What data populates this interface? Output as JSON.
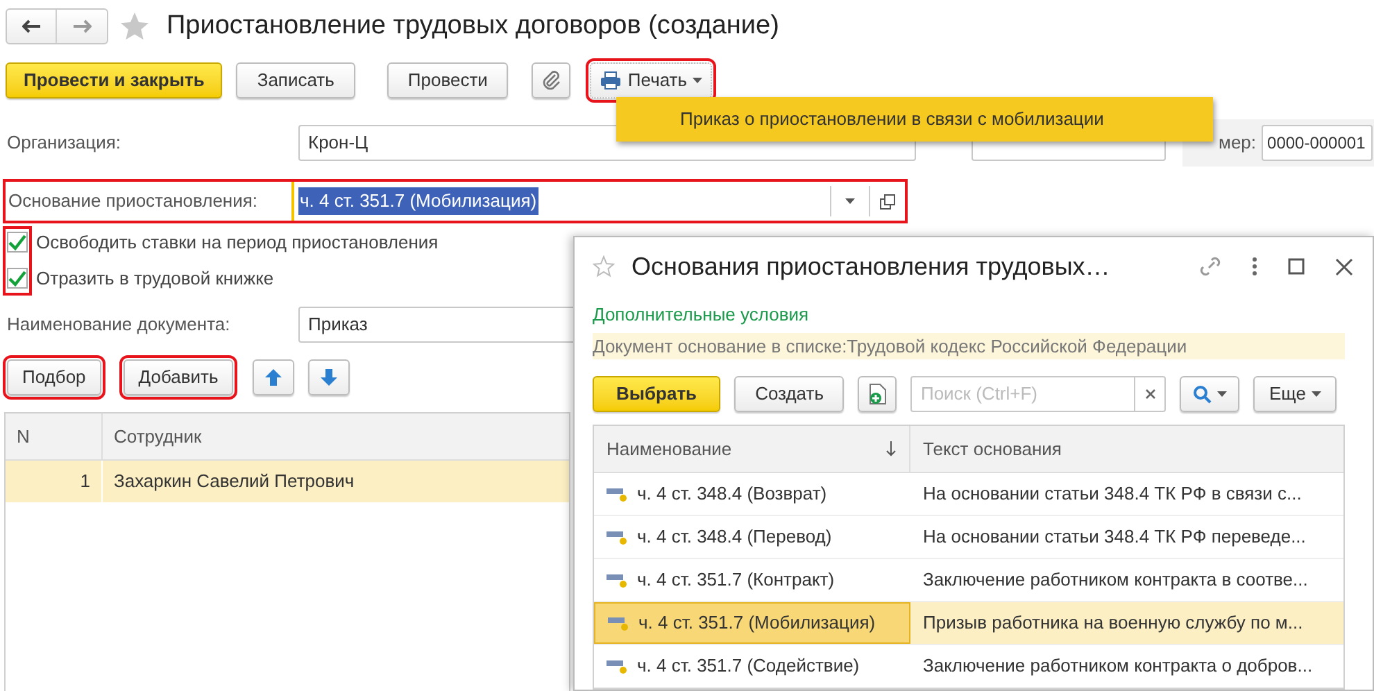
{
  "window": {
    "title": "Приостановление трудовых договоров (создание)"
  },
  "toolbar": [
    {
      "label": "Провести и закрыть",
      "kind": "primary",
      "highlighted": false
    },
    {
      "label": "Записать",
      "kind": "text",
      "highlighted": false
    },
    {
      "label": "Провести",
      "kind": "text",
      "highlighted": false
    },
    {
      "kind": "attach",
      "highlighted": false
    },
    {
      "label": "Печать",
      "kind": "print",
      "highlighted": true
    }
  ],
  "print_menu": {
    "items": [
      "Приказ о приостановлении в связи с мобилизации"
    ]
  },
  "organization": {
    "label": "Организация:",
    "value": "Крон-Ц"
  },
  "number": {
    "label": "мер:",
    "value": "0000-000001"
  },
  "basis": {
    "label": "Основание приостановления:",
    "value": "ч. 4 ст. 351.7 (Мобилизация)",
    "highlighted": true
  },
  "checkboxes": [
    {
      "label": "Освободить ставки на период приостановления",
      "checked": true
    },
    {
      "label": "Отразить в трудовой книжке",
      "checked": true
    }
  ],
  "document_name": {
    "label": "Наименование документа:",
    "value": "Приказ"
  },
  "table_buttons": [
    {
      "label": "Подбор",
      "kind": "text",
      "highlighted": true
    },
    {
      "label": "Добавить",
      "kind": "text",
      "highlighted": true
    },
    {
      "kind": "up",
      "highlighted": false
    },
    {
      "kind": "down",
      "highlighted": false
    }
  ],
  "table": {
    "columns": [
      "N",
      "Сотрудник"
    ],
    "rows": [
      {
        "cells": [
          "1",
          "Захаркин Савелий Петрович"
        ],
        "selected": true
      }
    ]
  },
  "dialog": {
    "title": "Основания приостановления трудовых…",
    "link": "Дополнительные условия",
    "filter": "Документ основание в списке:Трудовой кодекс Российской Федерации",
    "buttons": [
      {
        "label": "Выбрать",
        "kind": "primary"
      },
      {
        "label": "Создать",
        "kind": "text"
      },
      {
        "kind": "new"
      }
    ],
    "search": {
      "placeholder": "Поиск (Ctrl+F)"
    },
    "more": "Еще",
    "columns": [
      "Наименование",
      "Текст основания"
    ],
    "rows": [
      {
        "cells": [
          "ч. 4 ст. 348.4 (Возврат)",
          "На основании статьи 348.4 ТК РФ в связи с..."
        ],
        "selected": false
      },
      {
        "cells": [
          "ч. 4 ст. 348.4 (Перевод)",
          "На основании статьи 348.4 ТК РФ переведе..."
        ],
        "selected": false
      },
      {
        "cells": [
          "ч. 4 ст. 351.7 (Контракт)",
          "Заключение работником контракта в соотве..."
        ],
        "selected": false
      },
      {
        "cells": [
          "ч. 4 ст. 351.7 (Мобилизация)",
          "Призыв работника на военную службу по м..."
        ],
        "selected": true
      },
      {
        "cells": [
          "ч. 4 ст. 351.7 (Содействие)",
          "Заключение работником контракта о добров..."
        ],
        "selected": false
      }
    ]
  }
}
